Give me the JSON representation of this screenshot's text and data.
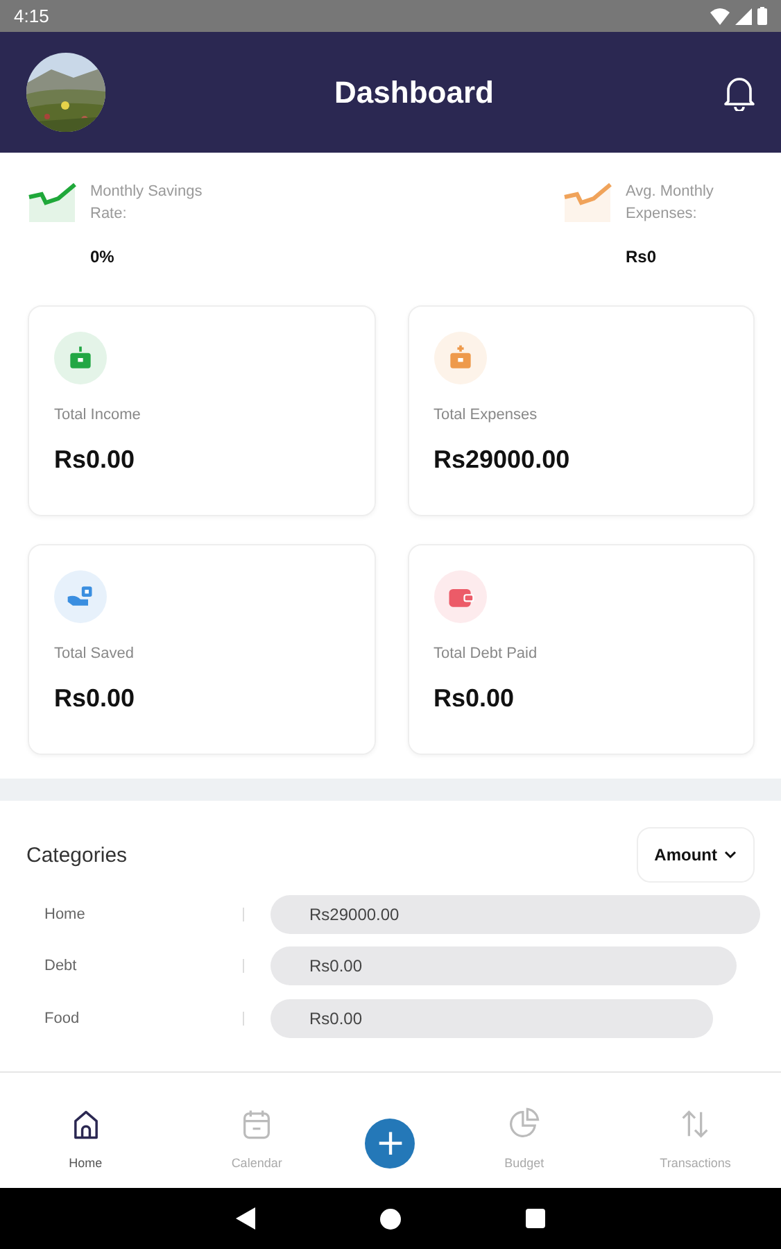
{
  "status_bar": {
    "time": "4:15"
  },
  "header": {
    "title": "Dashboard"
  },
  "stats": [
    {
      "label": "Monthly Savings Rate:",
      "value": "0%",
      "color": "#1fa83a"
    },
    {
      "label": "Avg. Monthly Expenses:",
      "value": "Rs0",
      "color": "#f0a35a"
    }
  ],
  "cards": [
    {
      "label": "Total Income",
      "value": "Rs0.00",
      "color": "#22a744"
    },
    {
      "label": "Total Expenses",
      "value": "Rs29000.00",
      "color": "#ee9a4c"
    },
    {
      "label": "Total Saved",
      "value": "Rs0.00",
      "color": "#3a8ee0"
    },
    {
      "label": "Total Debt Paid",
      "value": "Rs0.00",
      "color": "#ec5b68"
    }
  ],
  "categories": {
    "title": "Categories",
    "sort_button": "Amount",
    "rows": [
      {
        "name": "Home",
        "amount": "Rs29000.00"
      },
      {
        "name": "Debt",
        "amount": "Rs0.00"
      },
      {
        "name": "Food",
        "amount": "Rs0.00"
      }
    ]
  },
  "bottom_nav": {
    "items": [
      {
        "label": "Home",
        "selected": true
      },
      {
        "label": "Calendar",
        "selected": false
      },
      {
        "label": "Budget",
        "selected": false
      },
      {
        "label": "Transactions",
        "selected": false
      }
    ],
    "add_button": "+"
  }
}
